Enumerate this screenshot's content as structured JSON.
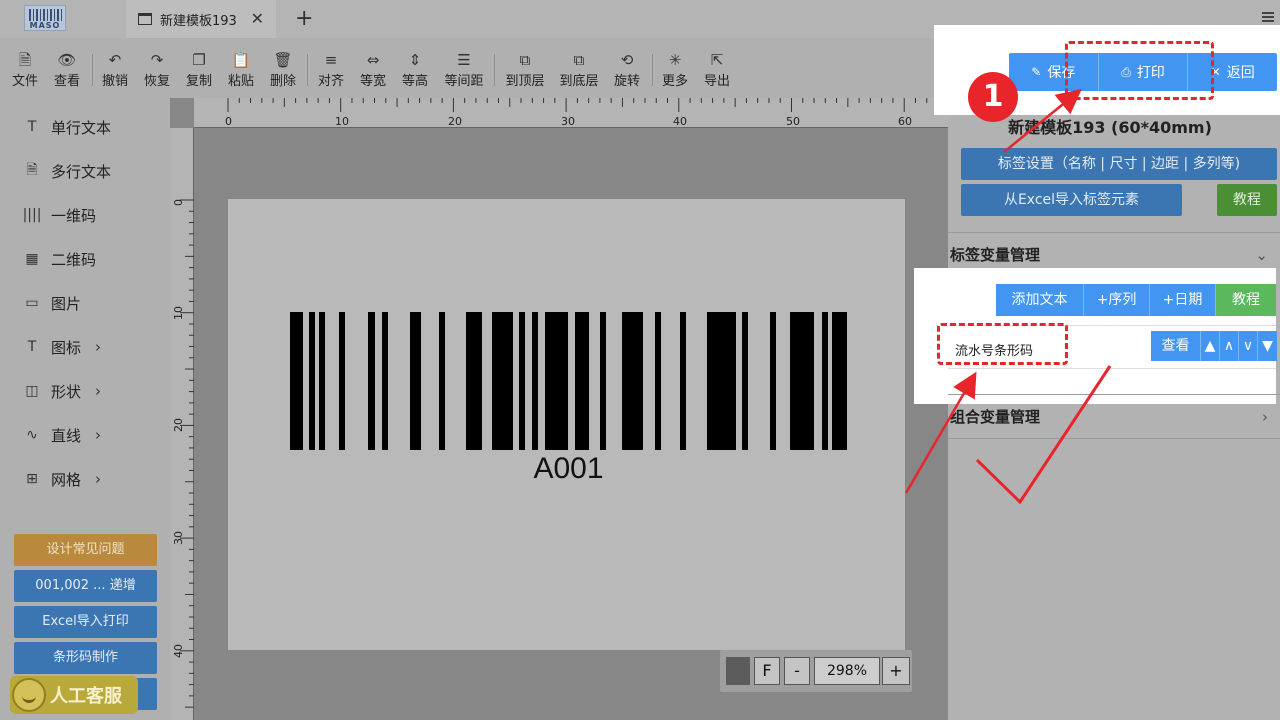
{
  "app": {
    "logo_text": "MASO",
    "tab_title": "新建模板193",
    "tab_close": "✕",
    "new_tab": "+"
  },
  "toolbar": {
    "items": [
      {
        "label": "文件",
        "icon": "file-icon"
      },
      {
        "label": "查看",
        "icon": "eye-icon"
      },
      {
        "label": "撤销",
        "icon": "undo-icon"
      },
      {
        "label": "恢复",
        "icon": "redo-icon"
      },
      {
        "label": "复制",
        "icon": "copy-icon"
      },
      {
        "label": "粘贴",
        "icon": "paste-icon"
      },
      {
        "label": "删除",
        "icon": "trash-icon"
      },
      {
        "label": "对齐",
        "icon": "align-icon"
      },
      {
        "label": "等宽",
        "icon": "equal-width-icon"
      },
      {
        "label": "等高",
        "icon": "equal-height-icon"
      },
      {
        "label": "等间距",
        "icon": "equal-spacing-icon"
      },
      {
        "label": "到顶层",
        "icon": "bring-front-icon"
      },
      {
        "label": "到底层",
        "icon": "send-back-icon"
      },
      {
        "label": "旋转",
        "icon": "rotate-icon"
      },
      {
        "label": "更多",
        "icon": "more-icon"
      },
      {
        "label": "导出",
        "icon": "export-icon"
      }
    ]
  },
  "sidebar": {
    "items": [
      {
        "label": "单行文本",
        "icon": "text-icon"
      },
      {
        "label": "多行文本",
        "icon": "multiline-text-icon"
      },
      {
        "label": "一维码",
        "icon": "barcode-icon"
      },
      {
        "label": "二维码",
        "icon": "qrcode-icon"
      },
      {
        "label": "图片",
        "icon": "image-icon"
      },
      {
        "label": "图标",
        "icon": "symbol-icon"
      },
      {
        "label": "形状",
        "icon": "shape-icon"
      },
      {
        "label": "直线",
        "icon": "line-icon"
      },
      {
        "label": "网格",
        "icon": "grid-icon"
      }
    ],
    "buttons": [
      "设计常见问题",
      "001,002 ... 递增",
      "Excel导入打印",
      "条形码制作"
    ],
    "service_label": "人工客服"
  },
  "rulers": {
    "top": [
      "0",
      "10",
      "20",
      "30",
      "40",
      "50",
      "60"
    ],
    "left": [
      "0",
      "10",
      "20",
      "30",
      "40"
    ]
  },
  "label": {
    "barcode_text": "A001"
  },
  "zoom": {
    "fit": "F",
    "minus": "-",
    "value": "298%",
    "plus": "+"
  },
  "right_panel": {
    "save": "保存",
    "print": "打印",
    "back": "返回",
    "step_badge": "1",
    "template_title": "新建模板193 (60*40mm)",
    "label_settings": "标签设置（名称 | 尺寸 | 边距 | 多列等)",
    "import_excel": "从Excel导入标签元素",
    "tutorial": "教程",
    "var_section": "标签变量管理",
    "add_text": "添加文本",
    "add_serial": "+序列",
    "add_date": "+日期",
    "var_tutorial": "教程",
    "variable_name": "流水号条形码",
    "view": "查看",
    "group_section": "组合变量管理"
  },
  "colors": {
    "accent_blue": "#4295f0",
    "annotation_red": "#e8252b",
    "tutorial_green": "#4a8f35"
  }
}
